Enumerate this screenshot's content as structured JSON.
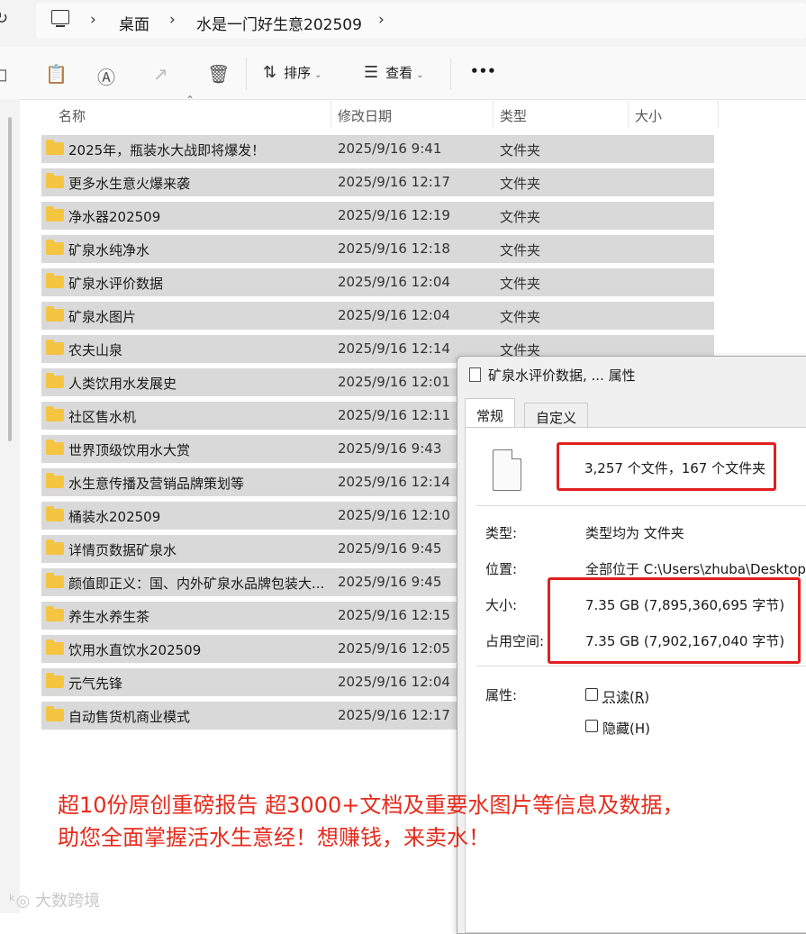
{
  "address_bar": {
    "refresh_icon": "refresh-icon",
    "pc_icon": "this-pc-icon",
    "crumbs": [
      "桌面",
      "水是一门好生意202509"
    ]
  },
  "toolbar": {
    "icons": [
      "share-icon",
      "paste-icon",
      "rename-icon",
      "share-out-icon",
      "delete-icon"
    ],
    "sort_label": "排序",
    "view_label": "查看",
    "more_label": "•••"
  },
  "columns": {
    "name": "名称",
    "modified": "修改日期",
    "type": "类型",
    "size": "大小"
  },
  "files": [
    {
      "name": "2025年，瓶装水大战即将爆发！",
      "date": "2025/9/16 9:41",
      "type": "文件夹"
    },
    {
      "name": "更多水生意火爆来袭",
      "date": "2025/9/16 12:17",
      "type": "文件夹"
    },
    {
      "name": "净水器202509",
      "date": "2025/9/16 12:19",
      "type": "文件夹"
    },
    {
      "name": "矿泉水纯净水",
      "date": "2025/9/16 12:18",
      "type": "文件夹"
    },
    {
      "name": "矿泉水评价数据",
      "date": "2025/9/16 12:04",
      "type": "文件夹"
    },
    {
      "name": "矿泉水图片",
      "date": "2025/9/16 12:04",
      "type": "文件夹"
    },
    {
      "name": "农夫山泉",
      "date": "2025/9/16 12:14",
      "type": "文件夹"
    },
    {
      "name": "人类饮用水发展史",
      "date": "2025/9/16 12:01",
      "type": ""
    },
    {
      "name": "社区售水机",
      "date": "2025/9/16 12:11",
      "type": ""
    },
    {
      "name": "世界顶级饮用水大赏",
      "date": "2025/9/16 9:43",
      "type": ""
    },
    {
      "name": "水生意传播及营销品牌策划等",
      "date": "2025/9/16 12:14",
      "type": ""
    },
    {
      "name": "桶装水202509",
      "date": "2025/9/16 12:10",
      "type": ""
    },
    {
      "name": "详情页数据矿泉水",
      "date": "2025/9/16 9:45",
      "type": ""
    },
    {
      "name": "颜值即正义：国、内外矿泉水品牌包装大...",
      "date": "2025/9/16 9:45",
      "type": ""
    },
    {
      "name": "养生水养生茶",
      "date": "2025/9/16 12:15",
      "type": ""
    },
    {
      "name": "饮用水直饮水202509",
      "date": "2025/9/16 12:05",
      "type": ""
    },
    {
      "name": "元气先锋",
      "date": "2025/9/16 12:04",
      "type": ""
    },
    {
      "name": "自动售货机商业模式",
      "date": "2025/9/16 12:17",
      "type": ""
    }
  ],
  "dialog": {
    "title": "矿泉水评价数据, ... 属性",
    "tabs": [
      "常规",
      "自定义"
    ],
    "summary": "3,257 个文件，167 个文件夹",
    "type_label": "类型:",
    "type_value": "类型均为 文件夹",
    "location_label": "位置:",
    "location_value": "全部位于 C:\\Users\\zhuba\\Desktop\\",
    "size_label": "大小:",
    "size_value": "7.35 GB (7,895,360,695 字节)",
    "disk_label": "占用空间:",
    "disk_value": "7.35 GB (7,902,167,040 字节)",
    "attr_label": "属性:",
    "readonly_label": "只读(R)",
    "hidden_label": "隐藏(H)"
  },
  "promo": {
    "line1": "超10份原创重磅报告 超3000+文档及重要水图片等信息及数据，",
    "line2": "助您全面掌握活水生意经！想赚钱，来卖水！"
  },
  "watermark": "大数跨境",
  "colors": {
    "row_bg": "#d9d9d9",
    "folder": "#f5c542",
    "highlight_box": "#e02020",
    "promo_text": "#e52a1b"
  }
}
